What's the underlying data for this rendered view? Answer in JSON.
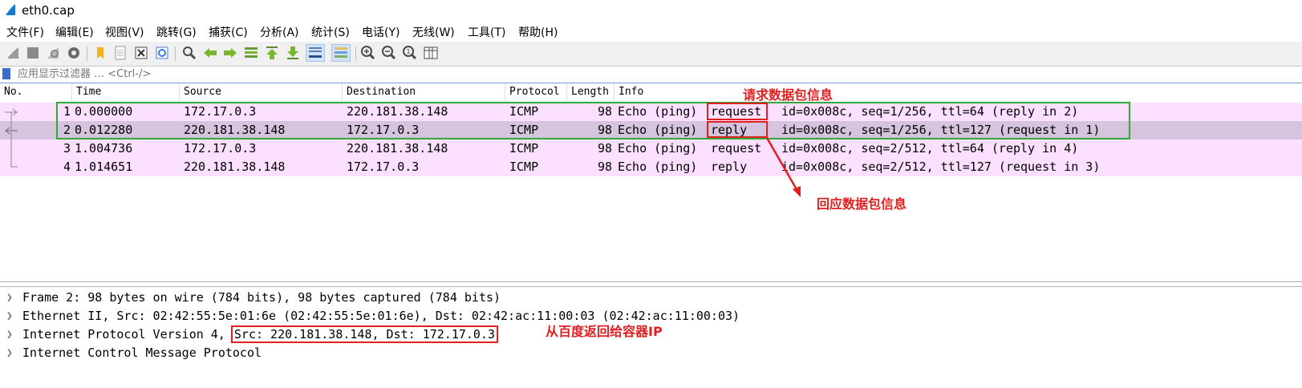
{
  "window": {
    "title": "eth0.cap",
    "icon": "wireshark-fin-icon"
  },
  "menu": [
    "文件(F)",
    "编辑(E)",
    "视图(V)",
    "跳转(G)",
    "捕获(C)",
    "分析(A)",
    "统计(S)",
    "电话(Y)",
    "无线(W)",
    "工具(T)",
    "帮助(H)"
  ],
  "toolbar_icons": [
    "start-capture-icon",
    "stop-capture-icon",
    "restart-capture-icon",
    "capture-options-icon",
    "open-file-icon",
    "save-file-icon",
    "close-file-icon",
    "reload-file-icon",
    "find-packet-icon",
    "go-back-icon",
    "go-forward-icon",
    "go-to-packet-icon",
    "first-packet-icon",
    "last-packet-icon",
    "autoscroll-icon",
    "colorize-icon",
    "zoom-in-icon",
    "zoom-out-icon",
    "zoom-normal-icon",
    "resize-columns-icon"
  ],
  "filter": {
    "placeholder": "应用显示过滤器 … <Ctrl-/>"
  },
  "packet_list": {
    "columns": [
      "No.",
      "Time",
      "Source",
      "Destination",
      "Protocol",
      "Length",
      "Info"
    ],
    "rows": [
      {
        "no": "1",
        "time": "0.000000",
        "source": "172.17.0.3",
        "destination": "220.181.38.148",
        "protocol": "ICMP",
        "length": "98",
        "info_a": "Echo (ping)",
        "info_b": "request",
        "info_c": "id=0x008c, seq=1/256, ttl=64 (reply in 2)",
        "bg": "#fce0ff"
      },
      {
        "no": "2",
        "time": "0.012280",
        "source": "220.181.38.148",
        "destination": "172.17.0.3",
        "protocol": "ICMP",
        "length": "98",
        "info_a": "Echo (ping)",
        "info_b": "reply",
        "info_c": "id=0x008c, seq=1/256, ttl=127 (request in 1)",
        "bg": "#d6c3dd"
      },
      {
        "no": "3",
        "time": "1.004736",
        "source": "172.17.0.3",
        "destination": "220.181.38.148",
        "protocol": "ICMP",
        "length": "98",
        "info_a": "Echo (ping)",
        "info_b": "request",
        "info_c": "id=0x008c, seq=2/512, ttl=64 (reply in 4)",
        "bg": "#fce0ff"
      },
      {
        "no": "4",
        "time": "1.014651",
        "source": "220.181.38.148",
        "destination": "172.17.0.3",
        "protocol": "ICMP",
        "length": "98",
        "info_a": "Echo (ping)",
        "info_b": "reply",
        "info_c": "id=0x008c, seq=2/512, ttl=127 (request in 3)",
        "bg": "#fce0ff"
      }
    ]
  },
  "details": {
    "rows": [
      {
        "text": "Frame 2: 98 bytes on wire (784 bits), 98 bytes captured (784 bits)"
      },
      {
        "text": "Ethernet II, Src: 02:42:55:5e:01:6e (02:42:55:5e:01:6e), Dst: 02:42:ac:11:00:03 (02:42:ac:11:00:03)"
      },
      {
        "text": "Internet Protocol Version 4, ",
        "highlight": "Src: 220.181.38.148, Dst: 172.17.0.3"
      },
      {
        "text": "Internet Control Message Protocol"
      }
    ]
  },
  "annotations": {
    "request_label": "请求数据包信息",
    "reply_label": "回应数据包信息",
    "ip_label": "从百度返回给容器IP",
    "color": "#e02020",
    "group_color": "#2eaa3c"
  }
}
